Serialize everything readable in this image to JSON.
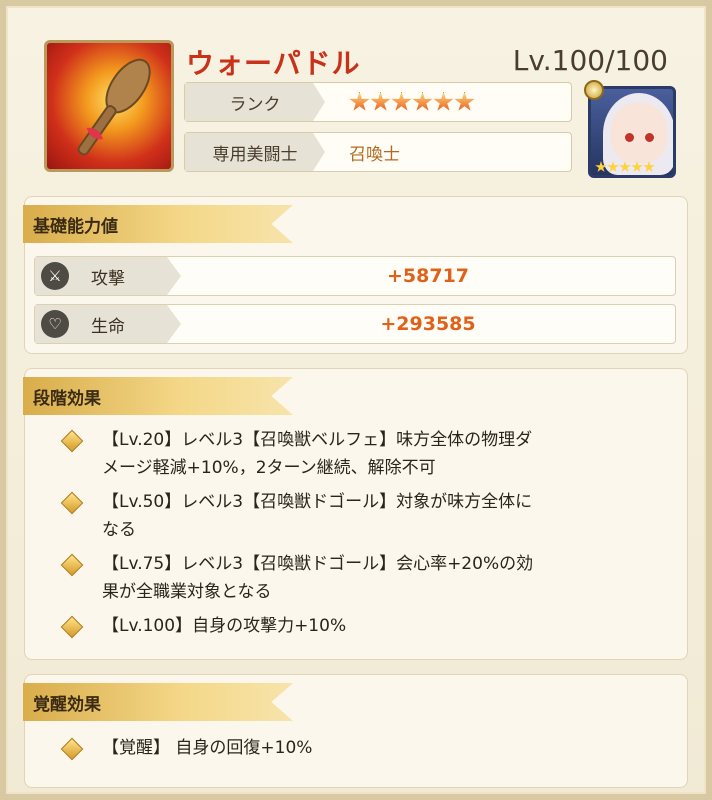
{
  "item": {
    "name": "ウォーパドル",
    "level": "Lv.100/100",
    "rank_label": "ランク",
    "rank_stars": 6,
    "exclusive_label": "専用美闘士",
    "exclusive_value": "召喚士"
  },
  "portrait": {
    "stars": 5
  },
  "basic": {
    "title": "基礎能力値",
    "attack_label": "攻撃",
    "attack_value": "+58717",
    "hp_label": "生命",
    "hp_value": "+293585"
  },
  "stage": {
    "title": "段階効果",
    "effects": [
      {
        "line1": "【Lv.20】レベル3【召喚獣ベルフェ】味方全体の物理ダ",
        "line2": "メージ軽減+10%，2ターン継続、解除不可"
      },
      {
        "line1": "【Lv.50】レベル3【召喚獣ドゴール】対象が味方全体に",
        "line2": "なる"
      },
      {
        "line1": "【Lv.75】レベル3【召喚獣ドゴール】会心率+20%の効",
        "line2": "果が全職業対象となる"
      },
      {
        "line1": "【Lv.100】自身の攻撃力+10%",
        "line2": ""
      }
    ]
  },
  "awaken": {
    "title": "覚醒効果",
    "effects": [
      {
        "line1": "【覚醒】 自身の回復+10%"
      }
    ]
  },
  "colors": {
    "title": "#c8321a",
    "value": "#e0621a",
    "ribbon": "#e8c46a"
  }
}
